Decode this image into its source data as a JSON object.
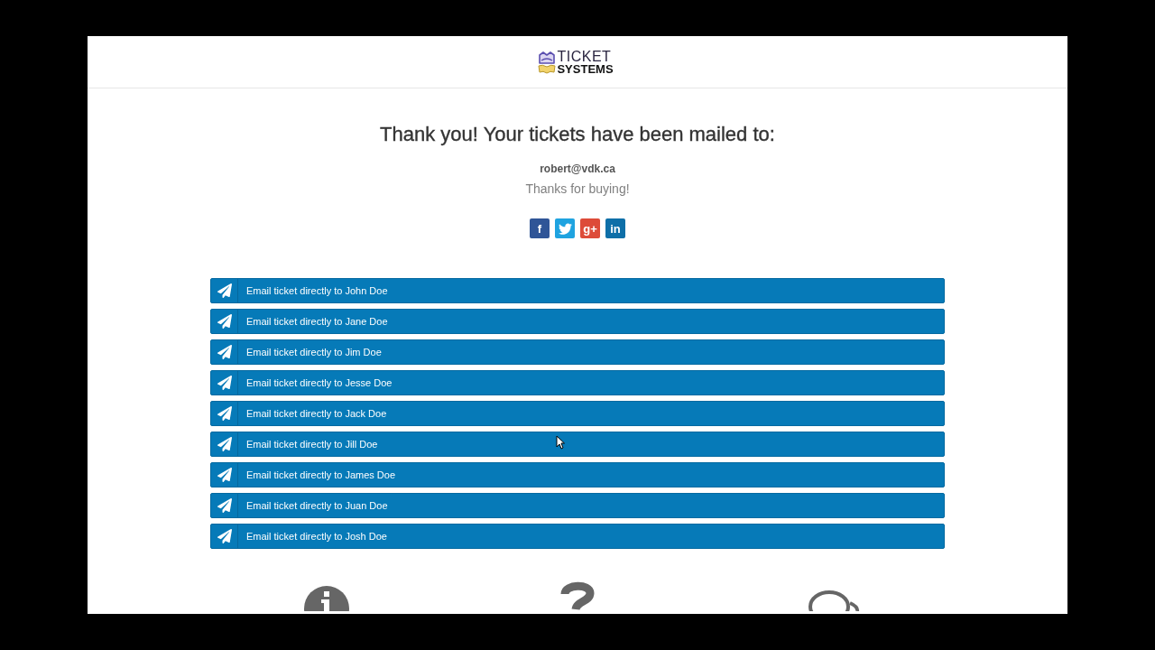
{
  "header": {
    "logo": {
      "top": "TICKET",
      "bottom": "SYSTEMS"
    }
  },
  "confirmation": {
    "heading": "Thank you! Your tickets have been mailed to:",
    "email": "robert@vdk.ca",
    "message": "Thanks for buying!"
  },
  "share_buttons": [
    {
      "kind": "letter",
      "glyph": "f",
      "color": "#2f5597"
    },
    {
      "kind": "bird",
      "color": "#1fa3e0"
    },
    {
      "kind": "letter",
      "glyph": "g+",
      "color": "#dd4b39"
    },
    {
      "kind": "letter",
      "glyph": "in",
      "color": "#0e6fa8"
    }
  ],
  "email_buttons": [
    {
      "label": "Email ticket directly to John Doe"
    },
    {
      "label": "Email ticket directly to Jane Doe"
    },
    {
      "label": "Email ticket directly to Jim Doe"
    },
    {
      "label": "Email ticket directly to Jesse Doe"
    },
    {
      "label": "Email ticket directly to Jack Doe"
    },
    {
      "label": "Email ticket directly to Jill Doe"
    },
    {
      "label": "Email ticket directly to James Doe"
    },
    {
      "label": "Email ticket directly to Juan Doe"
    },
    {
      "label": "Email ticket directly to Josh Doe"
    }
  ]
}
